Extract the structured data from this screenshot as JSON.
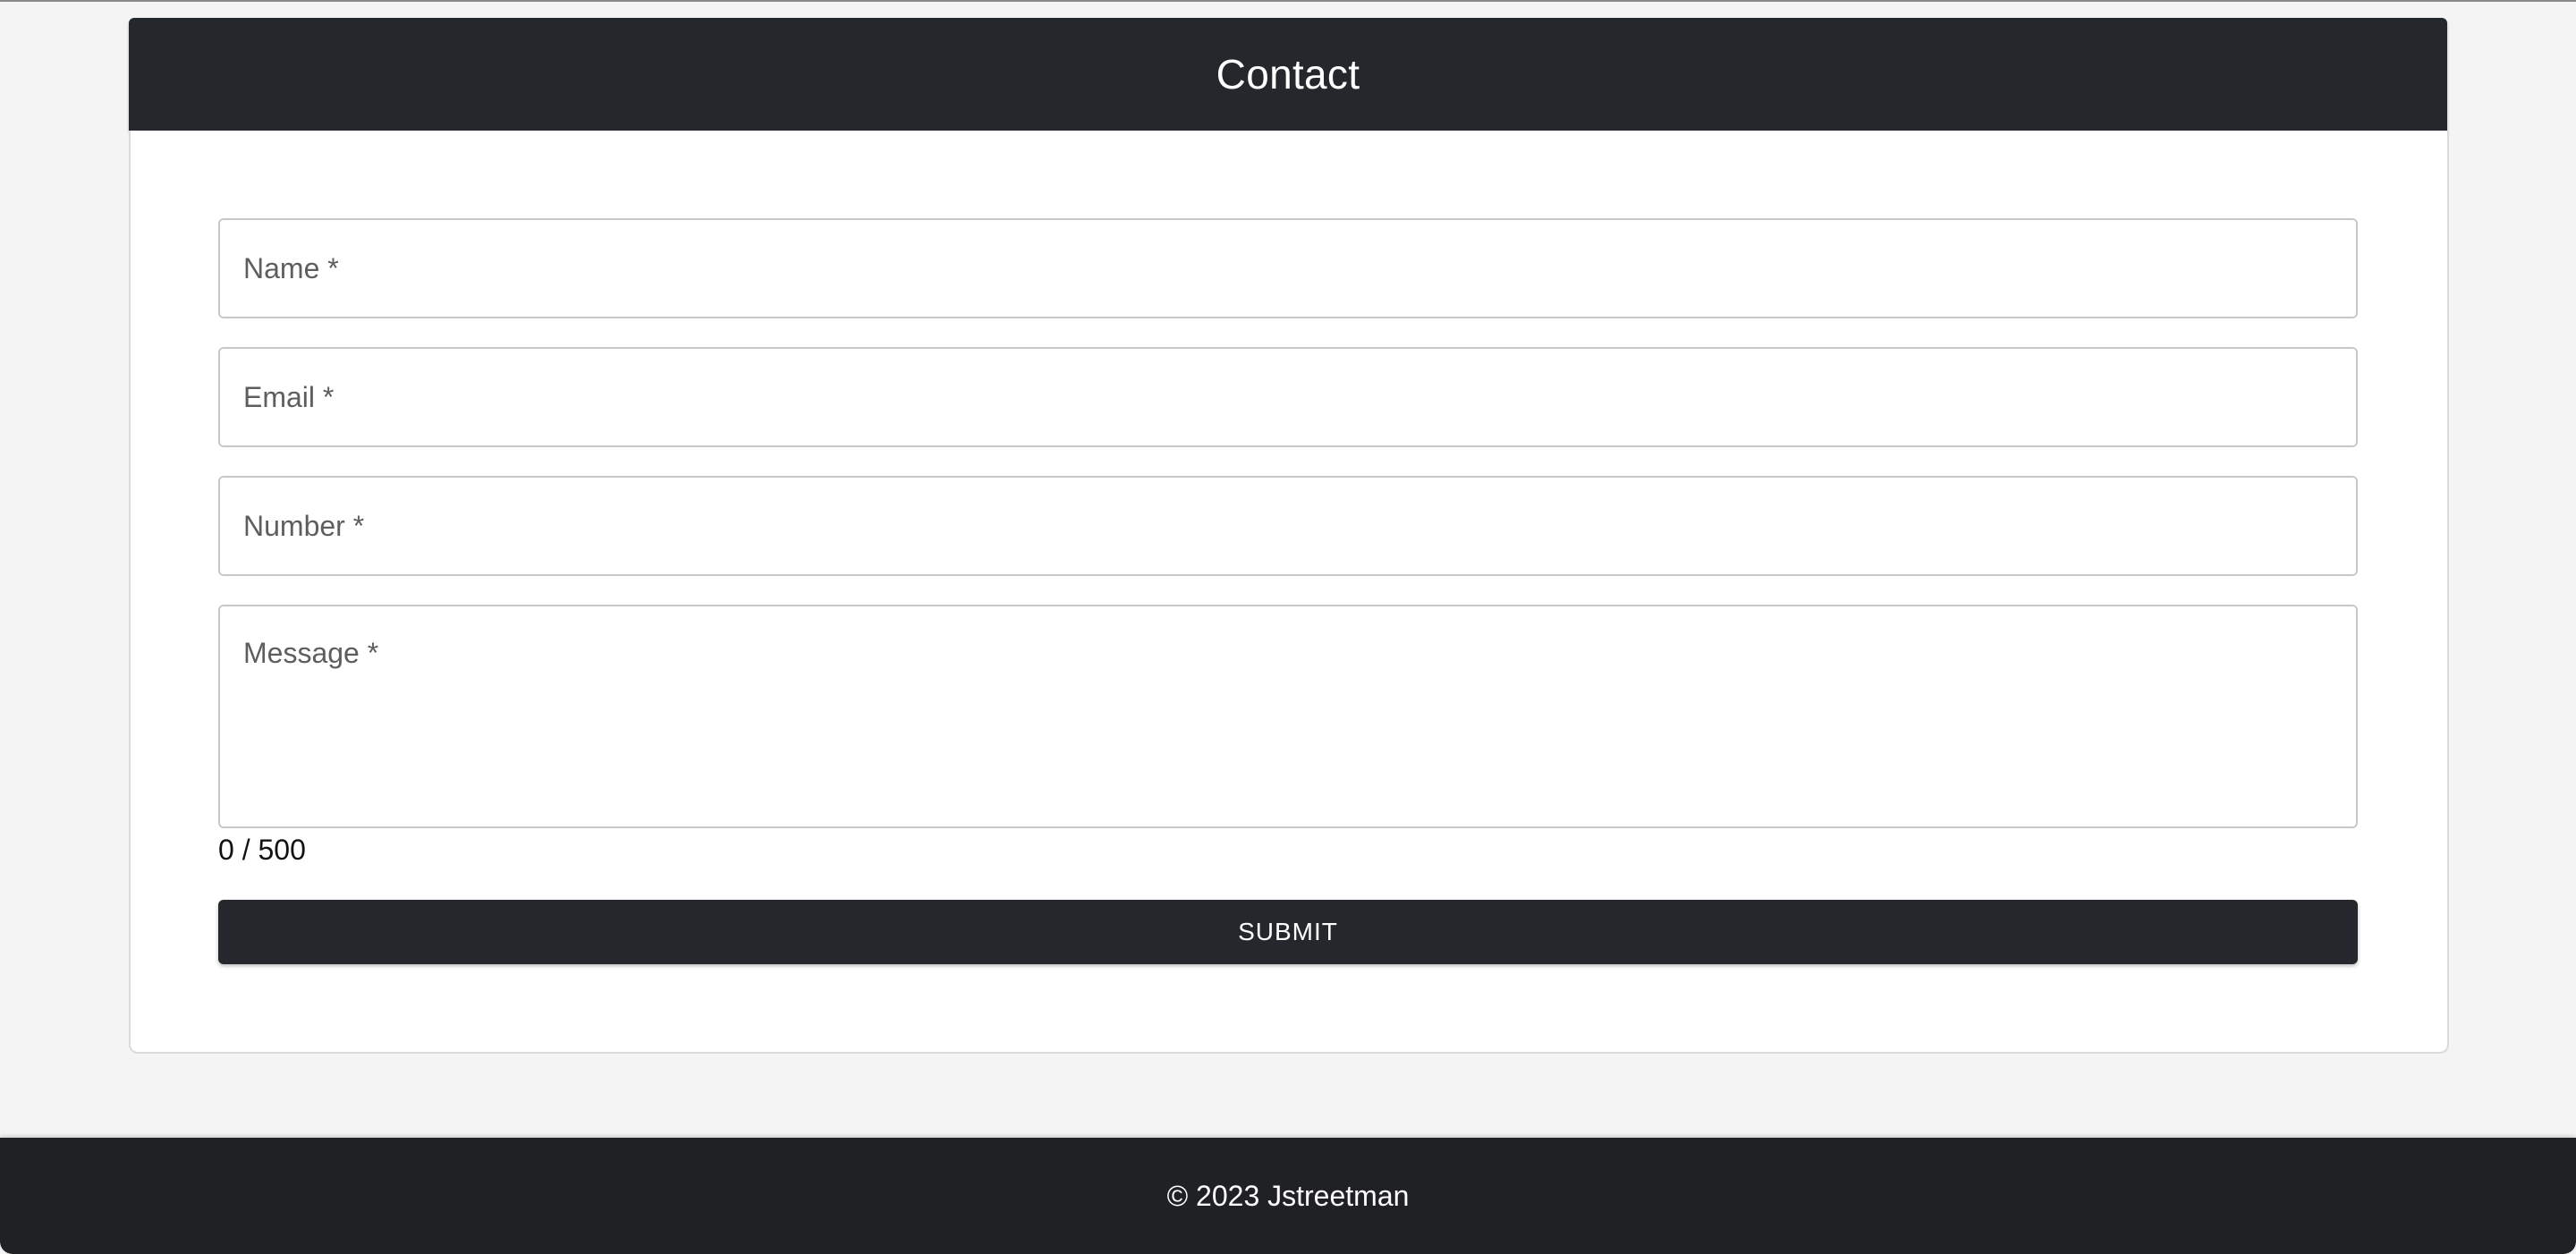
{
  "header": {
    "title": "Contact"
  },
  "form": {
    "name_label": "Name *",
    "email_label": "Email *",
    "number_label": "Number *",
    "message_label": "Message *",
    "message_counter": "0 / 500",
    "submit_label": "SUBMIT"
  },
  "footer": {
    "copyright": "© 2023 Jstreetman"
  },
  "colors": {
    "dark": "#24272b",
    "background": "#f4f4f4"
  }
}
